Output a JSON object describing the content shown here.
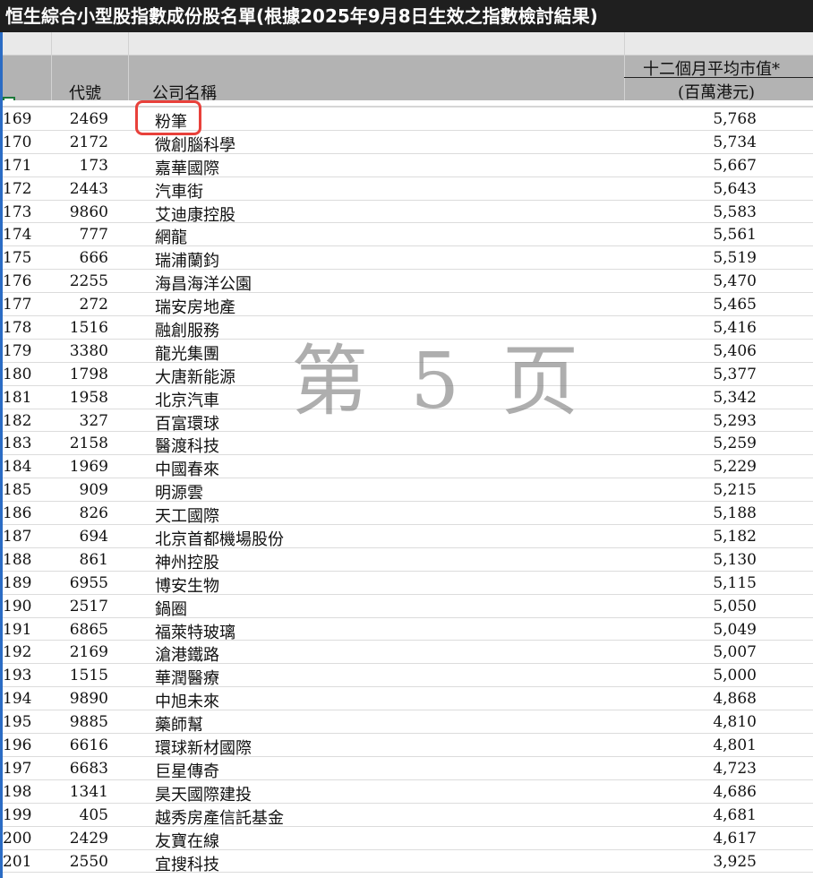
{
  "title": "恒生綜合小型股指數成份股名單(根據2025年9月8日生效之指數檢討結果)",
  "headers": {
    "code": "代號",
    "name": "公司名稱",
    "value_line1": "十二個月平均市值*",
    "value_line2": "(百萬港元)"
  },
  "watermark": "第 5 页",
  "rows": [
    {
      "idx": "169",
      "code": "2469",
      "name": "粉筆",
      "value": "5,768"
    },
    {
      "idx": "170",
      "code": "2172",
      "name": "微創腦科學",
      "value": "5,734"
    },
    {
      "idx": "171",
      "code": "173",
      "name": "嘉華國際",
      "value": "5,667"
    },
    {
      "idx": "172",
      "code": "2443",
      "name": "汽車街",
      "value": "5,643"
    },
    {
      "idx": "173",
      "code": "9860",
      "name": "艾迪康控股",
      "value": "5,583"
    },
    {
      "idx": "174",
      "code": "777",
      "name": "網龍",
      "value": "5,561"
    },
    {
      "idx": "175",
      "code": "666",
      "name": "瑞浦蘭鈞",
      "value": "5,519"
    },
    {
      "idx": "176",
      "code": "2255",
      "name": "海昌海洋公園",
      "value": "5,470"
    },
    {
      "idx": "177",
      "code": "272",
      "name": "瑞安房地產",
      "value": "5,465"
    },
    {
      "idx": "178",
      "code": "1516",
      "name": "融創服務",
      "value": "5,416"
    },
    {
      "idx": "179",
      "code": "3380",
      "name": "龍光集團",
      "value": "5,406"
    },
    {
      "idx": "180",
      "code": "1798",
      "name": "大唐新能源",
      "value": "5,377"
    },
    {
      "idx": "181",
      "code": "1958",
      "name": "北京汽車",
      "value": "5,342"
    },
    {
      "idx": "182",
      "code": "327",
      "name": "百富環球",
      "value": "5,293"
    },
    {
      "idx": "183",
      "code": "2158",
      "name": "醫渡科技",
      "value": "5,259"
    },
    {
      "idx": "184",
      "code": "1969",
      "name": "中國春來",
      "value": "5,229"
    },
    {
      "idx": "185",
      "code": "909",
      "name": "明源雲",
      "value": "5,215"
    },
    {
      "idx": "186",
      "code": "826",
      "name": "天工國際",
      "value": "5,188"
    },
    {
      "idx": "187",
      "code": "694",
      "name": "北京首都機場股份",
      "value": "5,182"
    },
    {
      "idx": "188",
      "code": "861",
      "name": "神州控股",
      "value": "5,130"
    },
    {
      "idx": "189",
      "code": "6955",
      "name": "博安生物",
      "value": "5,115"
    },
    {
      "idx": "190",
      "code": "2517",
      "name": "鍋圈",
      "value": "5,050"
    },
    {
      "idx": "191",
      "code": "6865",
      "name": "福萊特玻璃",
      "value": "5,049"
    },
    {
      "idx": "192",
      "code": "2169",
      "name": "滄港鐵路",
      "value": "5,007"
    },
    {
      "idx": "193",
      "code": "1515",
      "name": "華潤醫療",
      "value": "5,000"
    },
    {
      "idx": "194",
      "code": "9890",
      "name": "中旭未來",
      "value": "4,868"
    },
    {
      "idx": "195",
      "code": "9885",
      "name": "藥師幫",
      "value": "4,810"
    },
    {
      "idx": "196",
      "code": "6616",
      "name": "環球新材國際",
      "value": "4,801"
    },
    {
      "idx": "197",
      "code": "6683",
      "name": "巨星傳奇",
      "value": "4,723"
    },
    {
      "idx": "198",
      "code": "1341",
      "name": "昊天國際建投",
      "value": "4,686"
    },
    {
      "idx": "199",
      "code": "405",
      "name": "越秀房產信託基金",
      "value": "4,681"
    },
    {
      "idx": "200",
      "code": "2429",
      "name": "友寶在線",
      "value": "4,617"
    },
    {
      "idx": "201",
      "code": "2550",
      "name": "宜搜科技",
      "value": "3,925"
    }
  ]
}
